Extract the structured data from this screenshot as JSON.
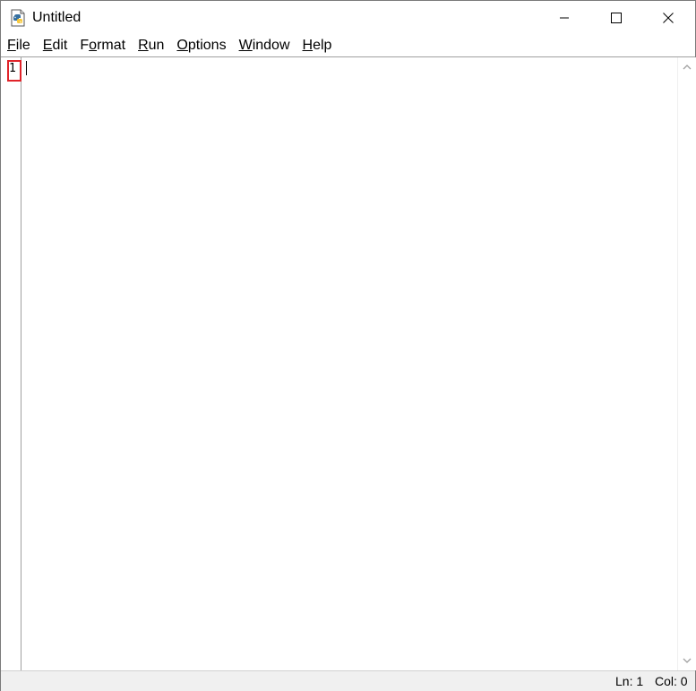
{
  "window": {
    "title": "Untitled",
    "icon": "python-idle-icon",
    "controls": {
      "minimize": "minimize-icon",
      "maximize": "maximize-icon",
      "close": "close-icon"
    }
  },
  "menubar": {
    "items": [
      {
        "accel": "F",
        "rest": "ile"
      },
      {
        "accel": "E",
        "rest": "dit"
      },
      {
        "pre": "F",
        "accel": "o",
        "rest": "rmat"
      },
      {
        "accel": "R",
        "rest": "un"
      },
      {
        "accel": "O",
        "rest": "ptions"
      },
      {
        "accel": "W",
        "rest": "indow"
      },
      {
        "accel": "H",
        "rest": "elp"
      }
    ]
  },
  "editor": {
    "line_numbers": [
      "1"
    ],
    "content": "",
    "highlight_color": "#e0242a"
  },
  "statusbar": {
    "line": "Ln: 1",
    "column": "Col: 0"
  }
}
